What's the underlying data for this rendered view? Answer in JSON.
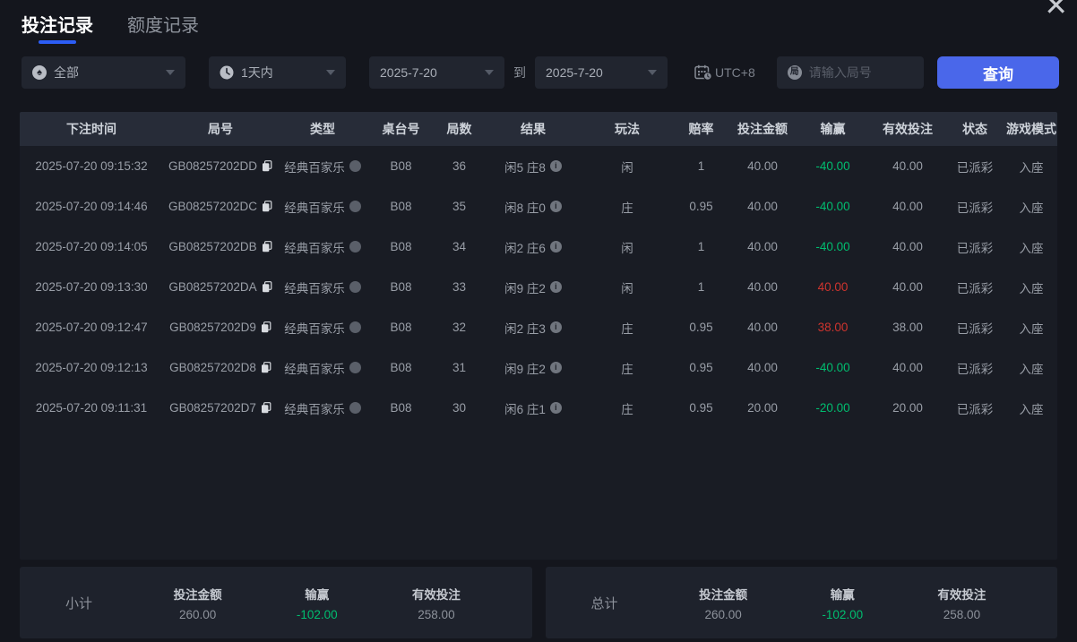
{
  "window": {
    "close_glyph": "✕"
  },
  "tabs": [
    {
      "label": "投注记录",
      "active": true
    },
    {
      "label": "额度记录",
      "active": false
    }
  ],
  "filters": {
    "game_type": {
      "value": "全部",
      "icon": "spade-icon",
      "icon_glyph": "♠"
    },
    "time_range": {
      "value": "1天内",
      "icon": "clock-icon"
    },
    "date_from": "2025-7-20",
    "to_label": "到",
    "date_to": "2025-7-20",
    "timezone": "UTC+8",
    "search": {
      "placeholder": "请输入局号",
      "icon_glyph": "局"
    },
    "query_button": "查询"
  },
  "table": {
    "headers": [
      "下注时间",
      "局号",
      "类型",
      "桌台号",
      "局数",
      "结果",
      "玩法",
      "赔率",
      "投注金额",
      "输赢",
      "有效投注",
      "状态",
      "游戏模式"
    ],
    "rows": [
      {
        "time": "2025-07-20 09:15:32",
        "game_no": "GB08257202DD",
        "type": "经典百家乐",
        "table_no": "B08",
        "round": "36",
        "result": "闲5 庄8",
        "play": "闲",
        "odds": "1",
        "bet": "40.00",
        "win_loss": "-40.00",
        "valid_bet": "40.00",
        "status": "已派彩",
        "mode": "入座"
      },
      {
        "time": "2025-07-20 09:14:46",
        "game_no": "GB08257202DC",
        "type": "经典百家乐",
        "table_no": "B08",
        "round": "35",
        "result": "闲8 庄0",
        "play": "庄",
        "odds": "0.95",
        "bet": "40.00",
        "win_loss": "-40.00",
        "valid_bet": "40.00",
        "status": "已派彩",
        "mode": "入座"
      },
      {
        "time": "2025-07-20 09:14:05",
        "game_no": "GB08257202DB",
        "type": "经典百家乐",
        "table_no": "B08",
        "round": "34",
        "result": "闲2 庄6",
        "play": "闲",
        "odds": "1",
        "bet": "40.00",
        "win_loss": "-40.00",
        "valid_bet": "40.00",
        "status": "已派彩",
        "mode": "入座"
      },
      {
        "time": "2025-07-20 09:13:30",
        "game_no": "GB08257202DA",
        "type": "经典百家乐",
        "table_no": "B08",
        "round": "33",
        "result": "闲9 庄2",
        "play": "闲",
        "odds": "1",
        "bet": "40.00",
        "win_loss": "40.00",
        "valid_bet": "40.00",
        "status": "已派彩",
        "mode": "入座"
      },
      {
        "time": "2025-07-20 09:12:47",
        "game_no": "GB08257202D9",
        "type": "经典百家乐",
        "table_no": "B08",
        "round": "32",
        "result": "闲2 庄3",
        "play": "庄",
        "odds": "0.95",
        "bet": "40.00",
        "win_loss": "38.00",
        "valid_bet": "38.00",
        "status": "已派彩",
        "mode": "入座"
      },
      {
        "time": "2025-07-20 09:12:13",
        "game_no": "GB08257202D8",
        "type": "经典百家乐",
        "table_no": "B08",
        "round": "31",
        "result": "闲9 庄2",
        "play": "庄",
        "odds": "0.95",
        "bet": "40.00",
        "win_loss": "-40.00",
        "valid_bet": "40.00",
        "status": "已派彩",
        "mode": "入座"
      },
      {
        "time": "2025-07-20 09:11:31",
        "game_no": "GB08257202D7",
        "type": "经典百家乐",
        "table_no": "B08",
        "round": "30",
        "result": "闲6 庄1",
        "play": "庄",
        "odds": "0.95",
        "bet": "20.00",
        "win_loss": "-20.00",
        "valid_bet": "20.00",
        "status": "已派彩",
        "mode": "入座"
      }
    ]
  },
  "summary": {
    "labels": {
      "bet": "投注金额",
      "win": "输赢",
      "valid": "有效投注"
    },
    "subtotal": {
      "label": "小计",
      "bet": "260.00",
      "win": "-102.00",
      "valid": "258.00"
    },
    "total": {
      "label": "总计",
      "bet": "260.00",
      "win": "-102.00",
      "valid": "258.00"
    }
  },
  "colors": {
    "accent_blue": "#4a67ea",
    "tab_underline": "#2c5df5",
    "loss_green": "#00bd6f",
    "win_red": "#cf342e"
  }
}
